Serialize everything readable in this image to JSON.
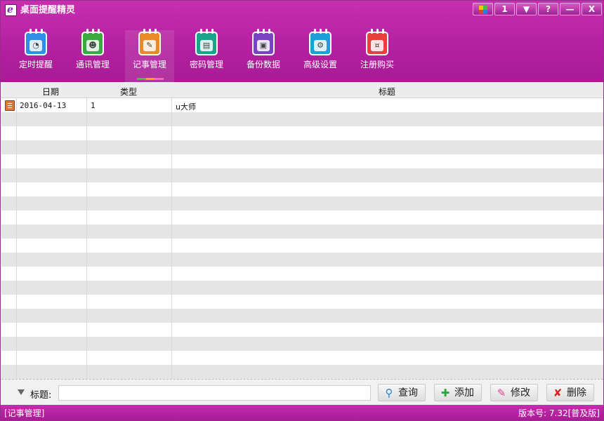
{
  "app": {
    "title": "桌面提醒精灵"
  },
  "titlebar_buttons": [
    {
      "icon": "color-palette-icon",
      "label": ""
    },
    {
      "icon": "calendar-icon",
      "label": "1"
    },
    {
      "icon": "dropdown-icon",
      "label": "▼"
    },
    {
      "icon": "help-icon",
      "label": "?"
    },
    {
      "icon": "minimize-icon",
      "label": "—"
    },
    {
      "icon": "close-icon",
      "label": "X"
    }
  ],
  "toolbar": {
    "items": [
      {
        "label": "定时提醒",
        "icon": "clock-calendar-icon",
        "color": "#2f8ee8"
      },
      {
        "label": "通讯管理",
        "icon": "contacts-icon",
        "color": "#3aaa3e"
      },
      {
        "label": "记事管理",
        "icon": "notepad-icon",
        "color": "#e9892a"
      },
      {
        "label": "密码管理",
        "icon": "wallet-icon",
        "color": "#1aa58a"
      },
      {
        "label": "备份数据",
        "icon": "floppy-disk-icon",
        "color": "#7a43c4"
      },
      {
        "label": "高级设置",
        "icon": "gear-icon",
        "color": "#1f9fd8"
      },
      {
        "label": "注册购买",
        "icon": "shopping-icon",
        "color": "#e8403d"
      }
    ],
    "active_index": 2
  },
  "table": {
    "columns": [
      "日期",
      "类型",
      "标题"
    ],
    "rows": [
      {
        "date": "2016-04-13",
        "type": "1",
        "title": "u大师"
      }
    ]
  },
  "search": {
    "label": "标题:",
    "value": "",
    "placeholder": "",
    "buttons": [
      {
        "label": "查询",
        "icon": "search-icon"
      },
      {
        "label": "添加",
        "icon": "plus-icon"
      },
      {
        "label": "修改",
        "icon": "pencil-icon"
      },
      {
        "label": "删除",
        "icon": "delete-x-icon"
      }
    ]
  },
  "status": {
    "left": "[记事管理]",
    "right": "版本号: 7.32[普及版]"
  }
}
